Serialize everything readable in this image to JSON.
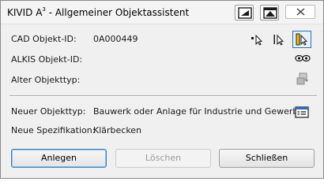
{
  "window": {
    "title_main": "KIVID A",
    "title_sup": "3",
    "title_rest": " - Allgemeiner Objektassistent"
  },
  "fields": {
    "cad_label": "CAD Objekt-ID:",
    "cad_value": "0A000449",
    "alkis_label": "ALKIS Objekt-ID:",
    "alter_label": "Alter Objekttyp:",
    "neuer_label": "Neuer Objekttyp:",
    "neuer_value": "Bauwerk oder Anlage für Industrie und Gewerbe",
    "spez_label": "Neue Spezifikation:",
    "spez_value": "Klärbecken"
  },
  "buttons": {
    "anlegen": "Anlegen",
    "loeschen": "Löschen",
    "schliessen": "Schließen"
  },
  "icons": {
    "minimize": "minimize-to-tray-icon",
    "restore": "collapse-up-icon",
    "close": "close-icon",
    "pick_point": "pick-point-cursor-icon",
    "pick_object": "pick-object-cursor-icon",
    "pick_active": "highlight-pick-cursor-icon",
    "view": "eyes-view-icon",
    "convert": "object-convert-icon",
    "type_select": "type-list-icon"
  },
  "colors": {
    "accent": "#2f6fb0",
    "highlight": "#f2c200"
  }
}
